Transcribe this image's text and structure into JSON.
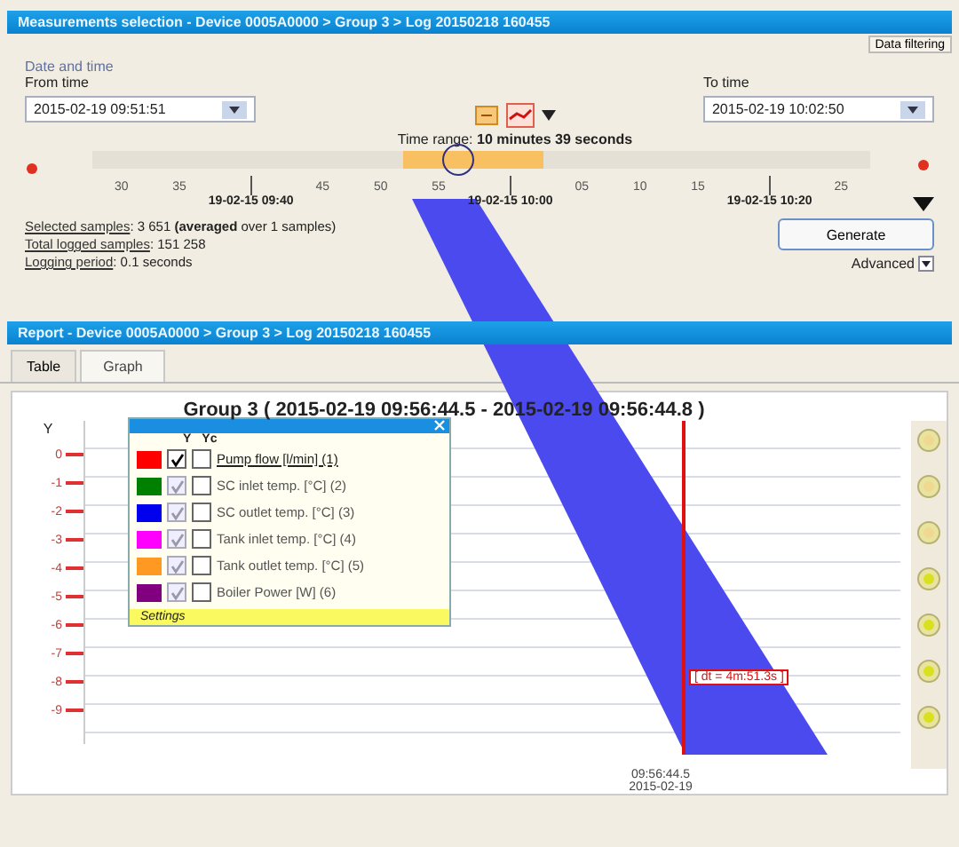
{
  "window": {
    "title": "Measurements selection - Device 0005A0000 > Group 3 > Log 20150218 160455"
  },
  "toolbar": {
    "filter_button": "Data filtering"
  },
  "date_time": {
    "group_label": "Date and time",
    "from_label": "From time",
    "from_value": "2015-02-19 09:51:51",
    "to_label": "To time",
    "to_value": "2015-02-19 10:02:50",
    "time_range": "Time range: **10 minutes 39 seconds**",
    "timeline": {
      "level": 0.47,
      "ticks": [
        {
          "kind": "minor",
          "label": "30"
        },
        {
          "kind": "minor",
          "label": "35"
        },
        {
          "kind": "major",
          "label": "19-02-15 09:40"
        },
        {
          "kind": "minor",
          "label": "45"
        },
        {
          "kind": "minor",
          "label": "50"
        },
        {
          "kind": "minor",
          "label": "55"
        },
        {
          "kind": "major",
          "label": "19-02-15 10:00"
        },
        {
          "kind": "minor",
          "label": "05"
        },
        {
          "kind": "minor",
          "label": "10"
        },
        {
          "kind": "minor",
          "label": "15"
        },
        {
          "kind": "major",
          "label": "19-02-15 10:20"
        },
        {
          "kind": "minor",
          "label": "25"
        }
      ]
    }
  },
  "stats": [
    {
      "label": "Selected samples",
      "value": ": 3 651 **(averaged** over 1 samples)"
    },
    {
      "label": "Total logged samples",
      "value": ": 151 258"
    },
    {
      "label": "Logging period",
      "value": ": 0.1 seconds"
    }
  ],
  "generate_button": "Generate",
  "advanced_dropdown": "Advanced",
  "report": {
    "title": "Report - Device 0005A0000 > Group 3 > Log 20150218 160455",
    "tabs": [
      {
        "label": "Table",
        "selected": false
      },
      {
        "label": "Graph",
        "selected": true
      }
    ]
  },
  "graph": {
    "title": "Group 3 ( 2015-02-19 09:56:44.5 - 2015-02-19 09:56:44.8 )",
    "y_axis_label": "Y",
    "y_ticks": [
      "0",
      "-1",
      "-2",
      "-3",
      "-4",
      "-5",
      "-6",
      "-7",
      "-8",
      "-9"
    ],
    "legend": {
      "headers": [
        "Y",
        "Yc"
      ],
      "series": [
        {
          "label": "Pump flow [l/min] (1)",
          "color": "#ff0000",
          "y_checked": true,
          "enabled": true,
          "yc_checked": false
        },
        {
          "label": "SC inlet temp. [°C] (2)",
          "color": "#008000",
          "y_checked": true,
          "enabled": false,
          "yc_checked": false
        },
        {
          "label": "SC outlet temp. [°C] (3)",
          "color": "#0000ee",
          "y_checked": true,
          "enabled": false,
          "yc_checked": false
        },
        {
          "label": "Tank inlet temp. [°C] (4)",
          "color": "#ff00ff",
          "y_checked": true,
          "enabled": false,
          "yc_checked": false
        },
        {
          "label": "Tank outlet temp. [°C] (5)",
          "color": "#ff9922",
          "y_checked": true,
          "enabled": false,
          "yc_checked": false
        },
        {
          "label": "Boiler Power [W] (6)",
          "color": "#800080",
          "y_checked": true,
          "enabled": false,
          "yc_checked": false
        }
      ],
      "settings": "Settings"
    },
    "cursor": {
      "readout": "[ dt = 4m:51.3s ]",
      "time": "09:56:44.5",
      "date": "2015-02-19"
    }
  }
}
